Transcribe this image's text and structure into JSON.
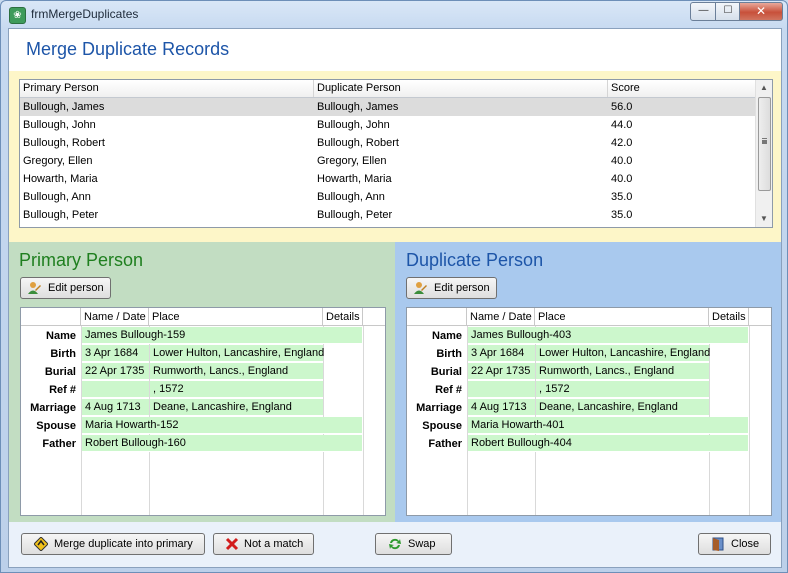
{
  "window": {
    "title": "frmMergeDuplicates",
    "min_glyph": "—",
    "max_glyph": "☐",
    "close_glyph": "✕",
    "app_icon_glyph": "❀"
  },
  "header": {
    "title": "Merge Duplicate Records"
  },
  "matches": {
    "columns": [
      "Primary Person",
      "Duplicate Person",
      "Score"
    ],
    "rows": [
      [
        "Bullough, James",
        "Bullough, James",
        "56.0"
      ],
      [
        "Bullough, John",
        "Bullough, John",
        "44.0"
      ],
      [
        "Bullough, Robert",
        "Bullough, Robert",
        "42.0"
      ],
      [
        "Gregory, Ellen",
        "Gregory, Ellen",
        "40.0"
      ],
      [
        "Howarth, Maria",
        "Howarth, Maria",
        "40.0"
      ],
      [
        "Bullough, Ann",
        "Bullough, Ann",
        "35.0"
      ],
      [
        "Bullough, Peter",
        "Bullough, Peter",
        "35.0"
      ]
    ],
    "selected_row": 0
  },
  "primary": {
    "title": "Primary Person",
    "edit_label": "Edit person",
    "columns": [
      "Name / Date",
      "Place",
      "Details"
    ],
    "rows": [
      {
        "label": "Name",
        "date": "James Bullough-159",
        "place": ""
      },
      {
        "label": "Birth",
        "date": "3 Apr 1684",
        "place": "Lower Hulton, Lancashire, England"
      },
      {
        "label": "Burial",
        "date": "22 Apr 1735",
        "place": "Rumworth, Lancs., England"
      },
      {
        "label": "Ref #",
        "date": "",
        "place": ", 1572"
      },
      {
        "label": "Marriage",
        "date": "4 Aug 1713",
        "place": "Deane, Lancashire, England"
      },
      {
        "label": "Spouse",
        "date": "Maria Howarth-152",
        "place": ""
      },
      {
        "label": "Father",
        "date": "Robert Bullough-160",
        "place": ""
      }
    ]
  },
  "duplicate": {
    "title": "Duplicate Person",
    "edit_label": "Edit person",
    "columns": [
      "Name / Date",
      "Place",
      "Details"
    ],
    "rows": [
      {
        "label": "Name",
        "date": "James Bullough-403",
        "place": ""
      },
      {
        "label": "Birth",
        "date": "3 Apr 1684",
        "place": "Lower Hulton, Lancashire, England"
      },
      {
        "label": "Burial",
        "date": "22 Apr 1735",
        "place": "Rumworth, Lancs., England"
      },
      {
        "label": "Ref #",
        "date": "",
        "place": ", 1572"
      },
      {
        "label": "Marriage",
        "date": "4 Aug 1713",
        "place": "Deane, Lancashire, England"
      },
      {
        "label": "Spouse",
        "date": "Maria Howarth-401",
        "place": ""
      },
      {
        "label": "Father",
        "date": "Robert Bullough-404",
        "place": ""
      }
    ]
  },
  "buttons": {
    "merge": "Merge duplicate into primary",
    "not_match": "Not a match",
    "swap": "Swap",
    "close": "Close"
  },
  "colors": {
    "primary_accent": "#1f7f1f",
    "duplicate_accent": "#1d55a8",
    "primary_bg": "#c2ddc2",
    "duplicate_bg": "#a9c9ee",
    "cell_green": "#ccf7cc"
  }
}
